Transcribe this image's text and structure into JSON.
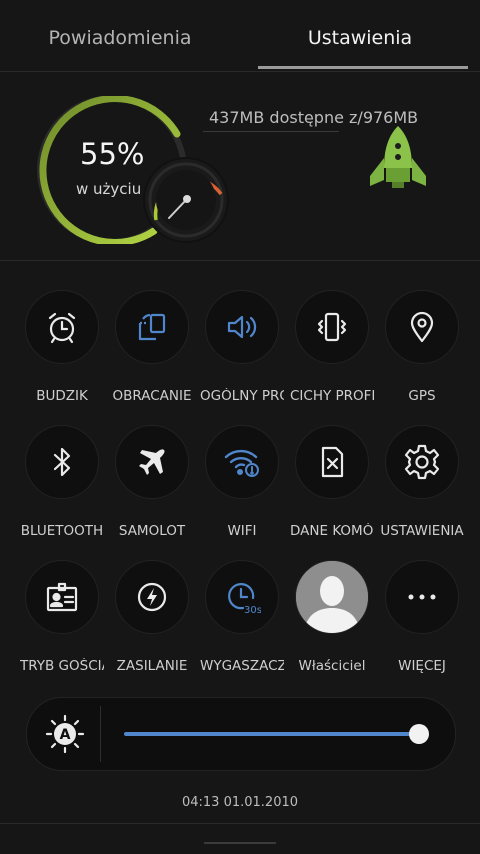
{
  "tabs": [
    {
      "label": "Powiadomienia",
      "active": false
    },
    {
      "label": "Ustawienia",
      "active": true
    }
  ],
  "memory": {
    "percent_text": "55%",
    "percent_value": 0.55,
    "usage_label": "w użyciu",
    "available_text": "437MB dostępne z/976MB",
    "boost_icon": "rocket-icon"
  },
  "toggles": [
    {
      "label": "BUDZIK",
      "icon": "alarm-clock-icon",
      "active": false
    },
    {
      "label": "OBRACANIE",
      "icon": "rotate-icon",
      "active": true
    },
    {
      "label": "OGÓLNY PROFIL",
      "icon": "speaker-icon",
      "active": true
    },
    {
      "label": "CICHY PROFIL",
      "icon": "vibrate-icon",
      "active": false
    },
    {
      "label": "GPS",
      "icon": "location-pin-icon",
      "active": false
    },
    {
      "label": "BLUETOOTH",
      "icon": "bluetooth-icon",
      "active": false
    },
    {
      "label": "SAMOLOT",
      "icon": "airplane-icon",
      "active": false
    },
    {
      "label": "WIFI",
      "icon": "wifi-icon",
      "active": true
    },
    {
      "label": "DANE KOMÓRKOWE",
      "icon": "no-sim-icon",
      "active": false
    },
    {
      "label": "USTAWIENIA",
      "icon": "gear-icon",
      "active": false
    },
    {
      "label": "TRYB GOŚCIA",
      "icon": "guest-badge-icon",
      "active": false
    },
    {
      "label": "ZASILANIE",
      "icon": "power-bolt-icon",
      "active": false
    },
    {
      "label": "WYGASZACZ",
      "icon": "timer-30s-icon",
      "active": true
    },
    {
      "label": "Właściciel",
      "icon": "user-avatar-icon",
      "active": false
    },
    {
      "label": "WIĘCEJ",
      "icon": "more-dots-icon",
      "active": false
    }
  ],
  "brightness": {
    "auto_icon": "auto-brightness-icon",
    "level": 0.97
  },
  "status": {
    "datetime": "04:13  01.01.2010"
  },
  "colors": {
    "accent": "#4f86cc",
    "gauge_start": "#9fcc34",
    "gauge_end": "#d23a2e",
    "rocket": "#8bc34a"
  }
}
